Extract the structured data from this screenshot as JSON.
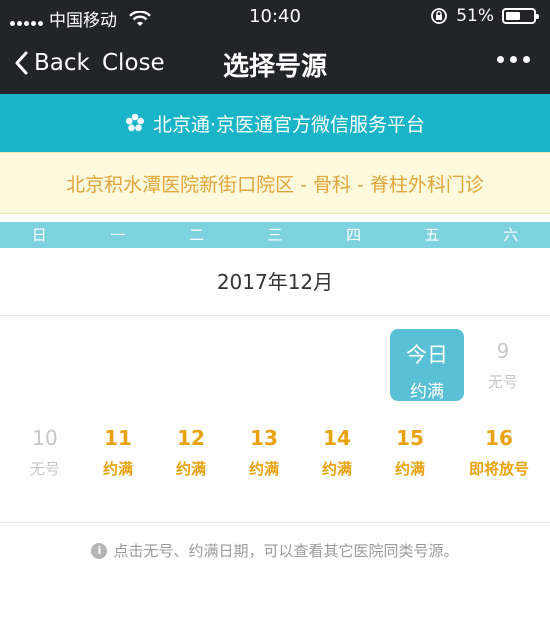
{
  "status_bar": {
    "carrier": "中国移动",
    "time": "10:40",
    "battery": "51%"
  },
  "nav": {
    "back_label": "Back",
    "close_label": "Close",
    "title": "选择号源"
  },
  "platform": {
    "title": "北京通·京医通官方微信服务平台",
    "icon": "flower-icon"
  },
  "department": {
    "name": "北京积水潭医院新街口院区 - 骨科 - 脊柱外科门诊"
  },
  "weekdays": [
    "日",
    "一",
    "二",
    "三",
    "四",
    "五",
    "六"
  ],
  "calendar": {
    "month_label": "2017年12月",
    "days": [
      {
        "day": "今日",
        "status": "约满",
        "state": "today"
      },
      {
        "day": "9",
        "status": "无号",
        "state": "none"
      },
      {
        "day": "10",
        "status": "无号",
        "state": "none"
      },
      {
        "day": "11",
        "status": "约满",
        "state": "full"
      },
      {
        "day": "12",
        "status": "约满",
        "state": "full"
      },
      {
        "day": "13",
        "status": "约满",
        "state": "full"
      },
      {
        "day": "14",
        "status": "约满",
        "state": "full"
      },
      {
        "day": "15",
        "status": "约满",
        "state": "full"
      },
      {
        "day": "16",
        "status": "即将放号",
        "state": "full"
      }
    ]
  },
  "tip": {
    "text": "点击无号、约满日期，可以查看其它医院同类号源。"
  },
  "colors": {
    "nav_bg": "#222428",
    "platform_bg": "#1ab4c9",
    "dept_text": "#e2a53a",
    "today_bg": "#59c0d6",
    "full_text": "#e9a20f",
    "none_text": "#c7c7c7"
  }
}
